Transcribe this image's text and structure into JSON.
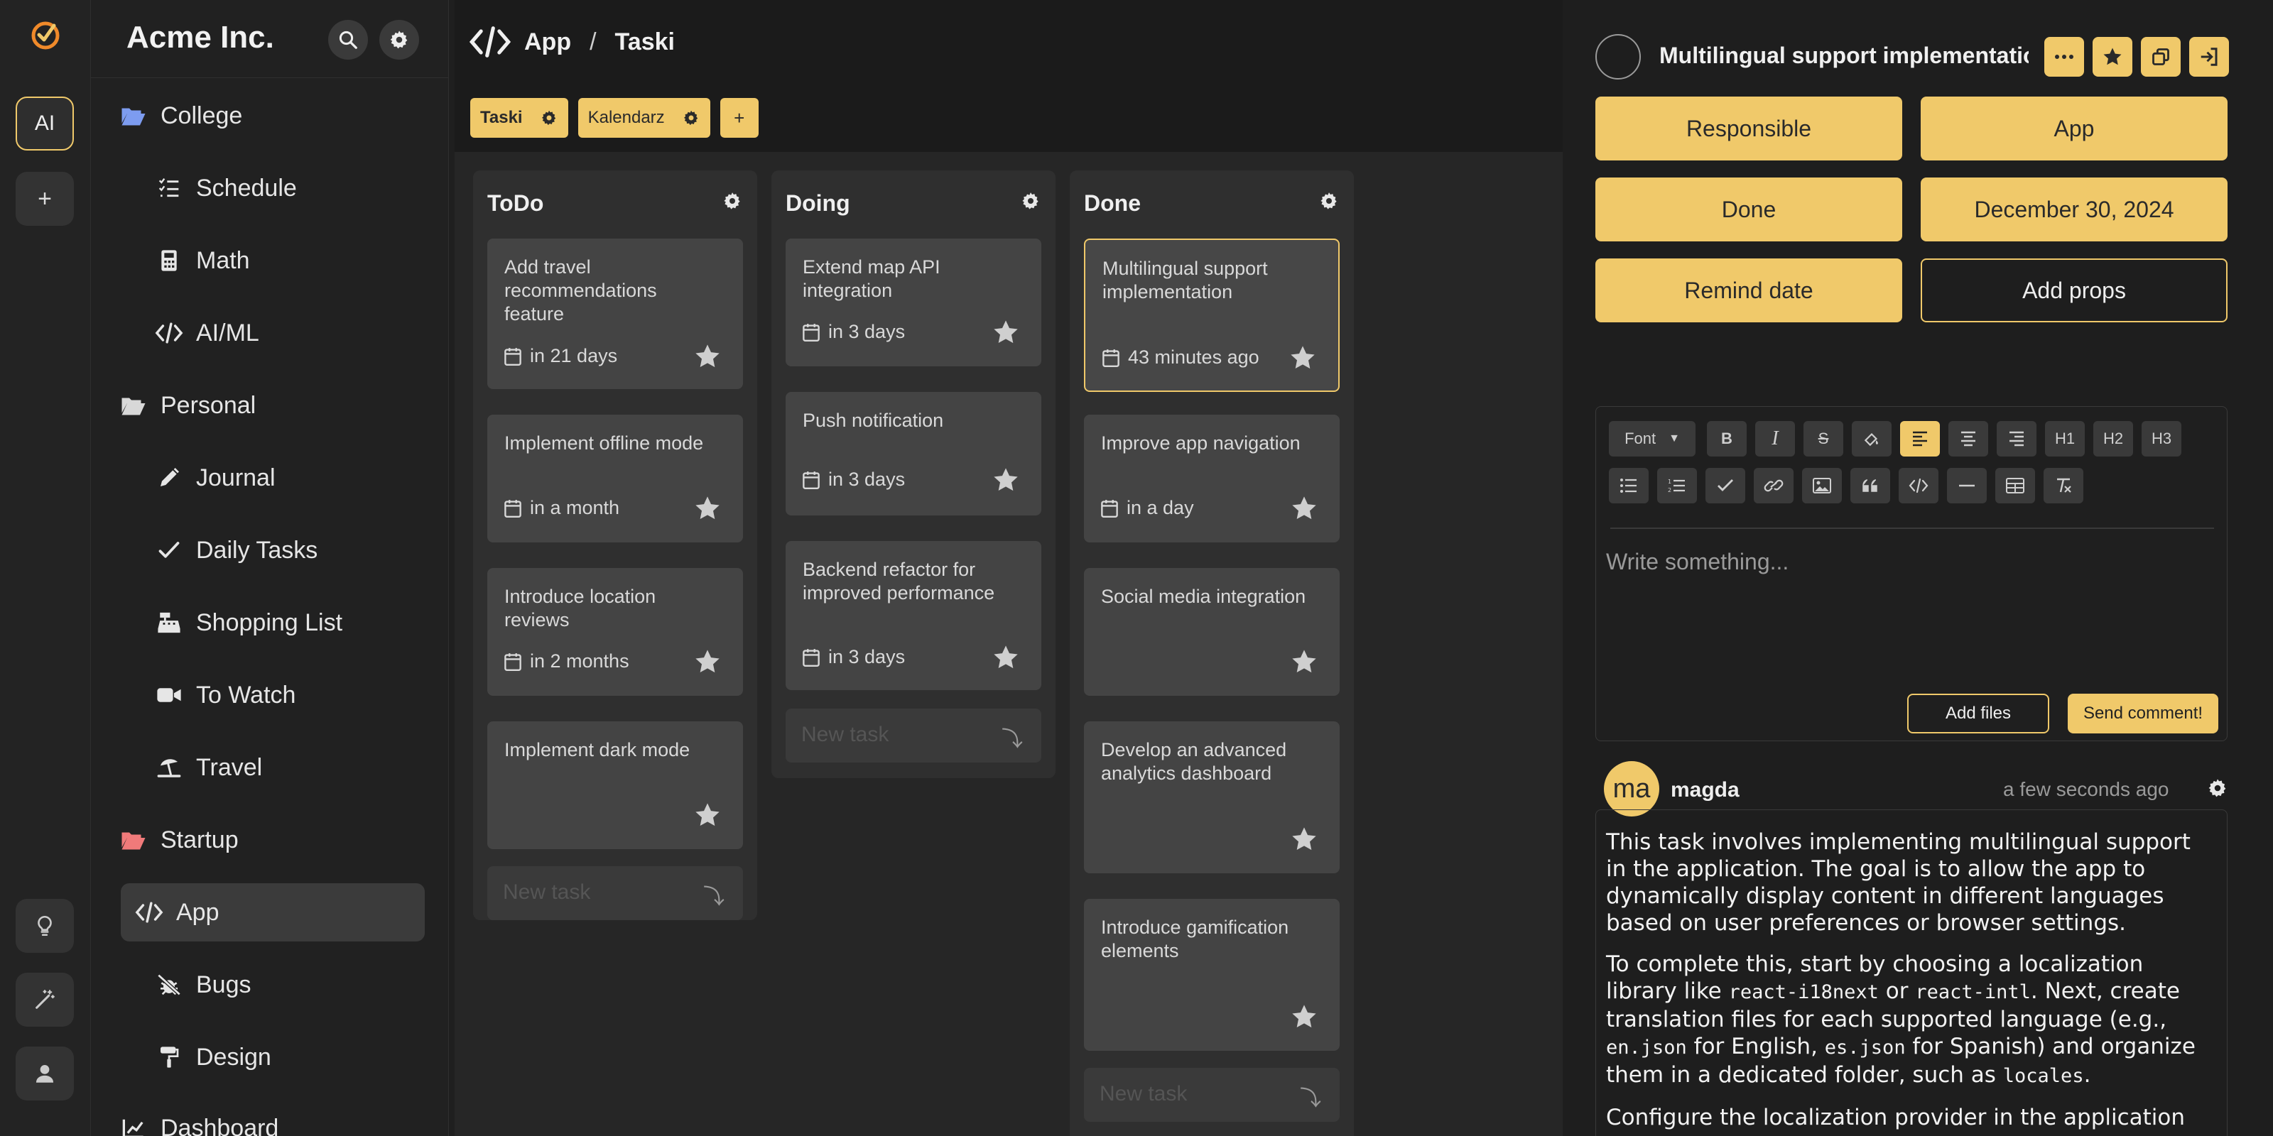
{
  "colors": {
    "accent": "#f0c96a",
    "background": "#1f1f1f",
    "card": "#444444"
  },
  "rail": {
    "ai_label": "AI",
    "add_label": "+"
  },
  "sidebar": {
    "title": "Acme Inc.",
    "items": [
      {
        "label": "College",
        "icon": "folder-open-icon",
        "kind": "folder",
        "color": "#7d9cf0"
      },
      {
        "label": "Schedule",
        "icon": "list-check-icon",
        "kind": "child"
      },
      {
        "label": "Math",
        "icon": "calculator-icon",
        "kind": "child"
      },
      {
        "label": "AI/ML",
        "icon": "code-icon",
        "kind": "child"
      },
      {
        "label": "Personal",
        "icon": "folder-open-icon",
        "kind": "folder",
        "color": "#d8d8d8"
      },
      {
        "label": "Journal",
        "icon": "pencil-icon",
        "kind": "child"
      },
      {
        "label": "Daily Tasks",
        "icon": "check-icon",
        "kind": "child"
      },
      {
        "label": "Shopping List",
        "icon": "cash-register-icon",
        "kind": "child"
      },
      {
        "label": "To Watch",
        "icon": "video-icon",
        "kind": "child"
      },
      {
        "label": "Travel",
        "icon": "umbrella-beach-icon",
        "kind": "child"
      },
      {
        "label": "Startup",
        "icon": "folder-open-icon",
        "kind": "folder",
        "color": "#f07a7a"
      },
      {
        "label": "App",
        "icon": "code-icon",
        "kind": "child",
        "active": true
      },
      {
        "label": "Bugs",
        "icon": "bug-slash-icon",
        "kind": "child"
      },
      {
        "label": "Design",
        "icon": "paint-roller-icon",
        "kind": "child"
      },
      {
        "label": "Dashboard",
        "icon": "chart-icon",
        "kind": "folder"
      }
    ]
  },
  "breadcrumb": {
    "project": "App",
    "separator": "/",
    "page": "Taski"
  },
  "tabs": [
    {
      "label": "Taski",
      "active": true
    },
    {
      "label": "Kalendarz",
      "active": false
    }
  ],
  "tab_add_label": "+",
  "columns": [
    {
      "title": "ToDo",
      "new_task_placeholder": "New task",
      "cards": [
        {
          "title": "Add travel recommendations feature",
          "date": "in 21 days"
        },
        {
          "title": "Implement offline mode",
          "date": "in a month"
        },
        {
          "title": "Introduce location reviews",
          "date": "in 2 months"
        },
        {
          "title": "Implement dark mode",
          "date": ""
        }
      ]
    },
    {
      "title": "Doing",
      "new_task_placeholder": "New task",
      "cards": [
        {
          "title": "Extend map API integration",
          "date": "in 3 days"
        },
        {
          "title": "Push notification",
          "date": "in 3 days"
        },
        {
          "title": "Backend refactor for improved performance",
          "date": "in 3 days"
        }
      ]
    },
    {
      "title": "Done",
      "new_task_placeholder": "New task",
      "cards": [
        {
          "title": "Multilingual support implementation",
          "date": "43 minutes ago",
          "selected": true
        },
        {
          "title": "Improve app navigation",
          "date": "in a day"
        },
        {
          "title": "Social media integration",
          "date": ""
        },
        {
          "title": "Develop an advanced analytics dashboard",
          "date": ""
        },
        {
          "title": "Introduce gamification elements",
          "date": ""
        }
      ]
    }
  ],
  "panel": {
    "title": "Multilingual support implementation",
    "props": {
      "responsible": "Responsible",
      "project": "App",
      "status": "Done",
      "date": "December 30, 2024",
      "remind": "Remind date",
      "add_props": "Add props"
    },
    "editor": {
      "font_label": "Font",
      "h1": "H1",
      "h2": "H2",
      "h3": "H3",
      "placeholder": "Write something...",
      "add_files": "Add files",
      "send": "Send comment!"
    },
    "comment": {
      "avatar_initials": "ma",
      "user": "magda",
      "time": "a few seconds ago",
      "p1": "This task involves implementing multilingual support in the application. The goal is to allow the app to dynamically display content in different languages based on user preferences or browser settings.",
      "p2_a": "To complete this, start by choosing a localization library like ",
      "p2_code1": "react-i18next",
      "p2_b": " or ",
      "p2_code2": "react-intl",
      "p2_c": ". Next, create translation files for each supported language (e.g., ",
      "p2_code3": "en.json",
      "p2_d": " for English, ",
      "p2_code4": "es.json",
      "p2_e": " for Spanish) and organize them in a dedicated folder, such as ",
      "p2_code5": "locales",
      "p2_f": ".",
      "p3": "Configure the localization provider in the application"
    }
  }
}
